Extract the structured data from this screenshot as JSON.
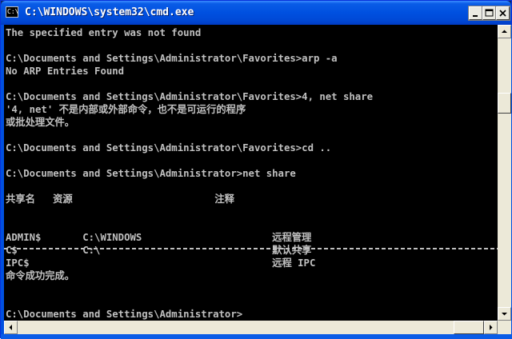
{
  "window": {
    "title": "C:\\WINDOWS\\system32\\cmd.exe",
    "icon_label": "C:\\",
    "icon": "console-icon"
  },
  "titlebar_buttons": {
    "minimize_icon": "minimize-icon",
    "maximize_icon": "maximize-icon",
    "close_icon": "close-icon"
  },
  "console": {
    "lines": [
      "The specified entry was not found",
      "",
      "C:\\Documents and Settings\\Administrator\\Favorites>arp -a",
      "No ARP Entries Found",
      "",
      "C:\\Documents and Settings\\Administrator\\Favorites>4, net share",
      "'4, net' 不是内部或外部命令，也不是可运行的程序",
      "或批处理文件。",
      "",
      "C:\\Documents and Settings\\Administrator\\Favorites>cd ..",
      "",
      "C:\\Documents and Settings\\Administrator>net share",
      "",
      "共享名   资源                        注释",
      "",
      "",
      "ADMIN$       C:\\WINDOWS                      远程管理",
      "C$           C:\\                             默认共享",
      "IPC$                                         远程 IPC",
      "命令成功完成。",
      "",
      "",
      "C:\\Documents and Settings\\Administrator>"
    ]
  },
  "colors": {
    "console_bg": "#000000",
    "console_fg": "#c0c0c0",
    "titlebar": "#0050e0"
  }
}
